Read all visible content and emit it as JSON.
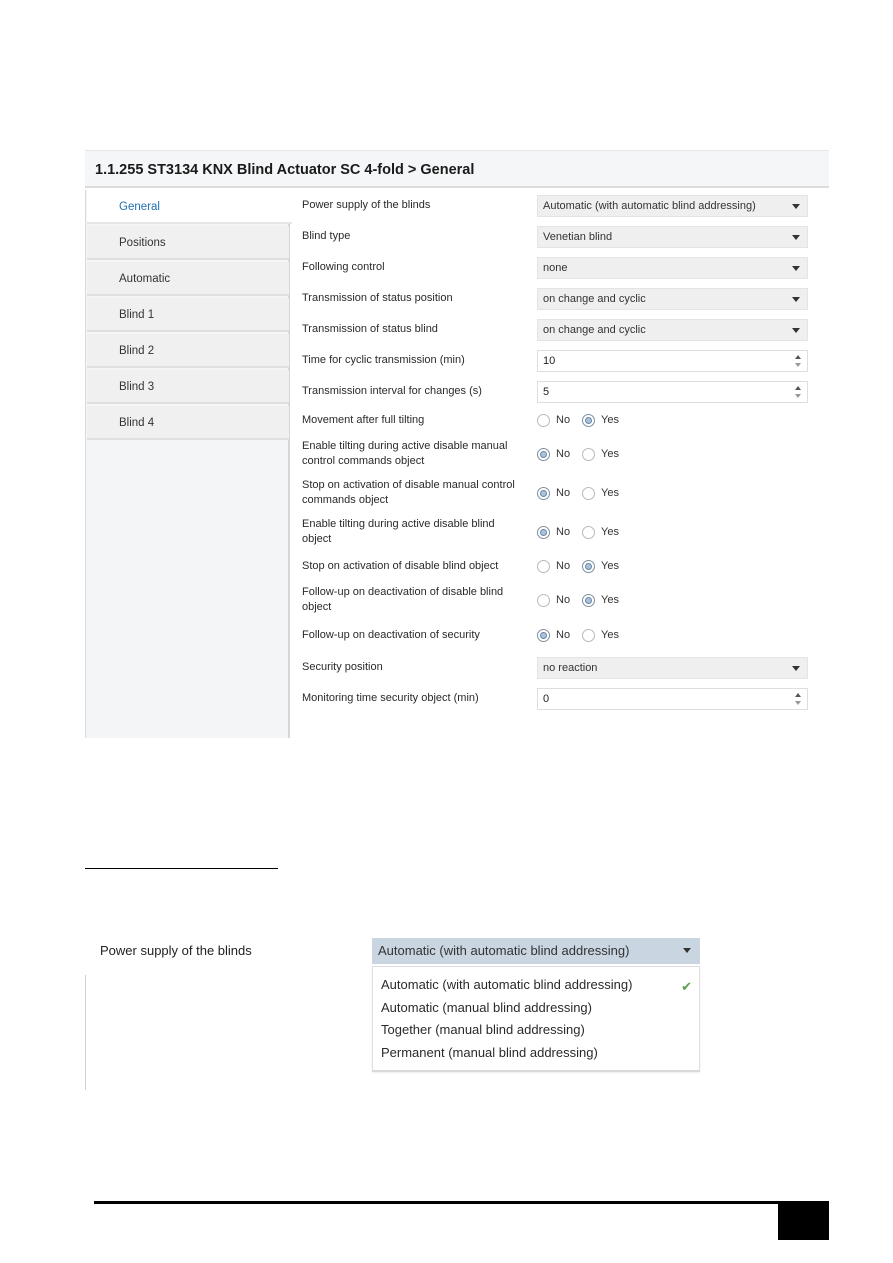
{
  "dialog": {
    "title": "1.1.255 ST3134 KNX Blind Actuator SC 4-fold > General",
    "sidebar": {
      "items": [
        {
          "label": "General",
          "active": true
        },
        {
          "label": "Positions",
          "active": false
        },
        {
          "label": "Automatic",
          "active": false
        },
        {
          "label": "Blind 1",
          "active": false
        },
        {
          "label": "Blind 2",
          "active": false
        },
        {
          "label": "Blind 3",
          "active": false
        },
        {
          "label": "Blind 4",
          "active": false
        }
      ]
    },
    "params": {
      "power_supply": {
        "label": "Power supply of the blinds",
        "value": "Automatic (with automatic blind addressing)"
      },
      "blind_type": {
        "label": "Blind type",
        "value": "Venetian blind"
      },
      "following_control": {
        "label": "Following control",
        "value": "none"
      },
      "status_position": {
        "label": "Transmission of status position",
        "value": "on change and cyclic"
      },
      "status_blind": {
        "label": "Transmission of status blind",
        "value": "on change and cyclic"
      },
      "cyclic_time": {
        "label": "Time for cyclic transmission (min)",
        "value": "10"
      },
      "change_interval": {
        "label": "Transmission interval for changes (s)",
        "value": "5"
      },
      "movement_after_tilting": {
        "label": "Movement after full tilting",
        "selected": "Yes"
      },
      "tilting_disable_manual": {
        "label": "Enable tilting during active disable manual control commands object",
        "selected": "No"
      },
      "stop_disable_manual": {
        "label": "Stop on activation of disable manual control commands object",
        "selected": "No"
      },
      "tilting_disable_blind": {
        "label": "Enable tilting during active disable blind object",
        "selected": "No"
      },
      "stop_disable_blind": {
        "label": "Stop on activation of disable blind object",
        "selected": "Yes"
      },
      "followup_disable_blind": {
        "label": "Follow-up on deactivation of disable blind object",
        "selected": "Yes"
      },
      "followup_security": {
        "label": "Follow-up on deactivation of security",
        "selected": "No"
      },
      "security_position": {
        "label": "Security position",
        "value": "no reaction"
      },
      "monitoring_time": {
        "label": "Monitoring time security object (min)",
        "value": "0"
      }
    },
    "radio_labels": {
      "no": "No",
      "yes": "Yes"
    }
  },
  "detail": {
    "label": "Power supply of the blinds",
    "selected": "Automatic (with automatic blind addressing)",
    "options": [
      {
        "label": "Automatic (with automatic blind addressing)",
        "checked": true
      },
      {
        "label": "Automatic (manual blind addressing)",
        "checked": false
      },
      {
        "label": "Together (manual blind addressing)",
        "checked": false
      },
      {
        "label": "Permanent (manual blind addressing)",
        "checked": false
      }
    ],
    "check_icon": "✔"
  },
  "colors": {
    "accent": "#1f6fb0",
    "check": "#5aa04a",
    "detail_select_bg": "#c9d5e0"
  }
}
